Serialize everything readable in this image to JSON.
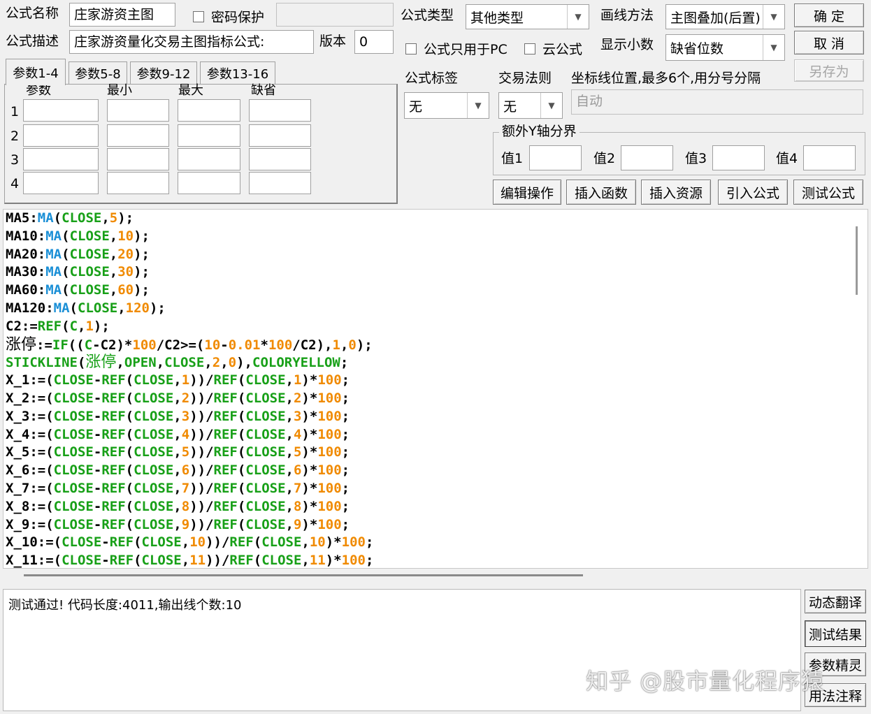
{
  "header": {
    "name_label": "公式名称",
    "name_value": "庄家游资主图",
    "password_label": "密码保护",
    "password_value": "",
    "desc_label": "公式描述",
    "desc_value": "庄家游资量化交易主图指标公式:",
    "version_label": "版本",
    "version_value": "0"
  },
  "settings": {
    "type_label": "公式类型",
    "type_value": "其他类型",
    "draw_label": "画线方法",
    "draw_value": "主图叠加(后置)",
    "pc_only_label": "公式只用于PC",
    "cloud_label": "云公式",
    "decimals_label": "显示小数",
    "decimals_value": "缺省位数",
    "tag_label": "公式标签",
    "tag_value": "无",
    "rule_label": "交易法则",
    "rule_value": "无",
    "axis_label": "坐标线位置,最多6个,用分号分隔",
    "axis_value": "自动",
    "yaxis_group": "额外Y轴分界",
    "y_values": [
      "值1",
      "值2",
      "值3",
      "值4"
    ]
  },
  "buttons": {
    "ok": "确  定",
    "cancel": "取  消",
    "save_as": "另存为",
    "edit": "编辑操作",
    "insert_func": "插入函数",
    "insert_res": "插入资源",
    "import": "引入公式",
    "test": "测试公式",
    "translate": "动态翻译",
    "test_result": "测试结果",
    "param_wizard": "参数精灵",
    "usage_notes": "用法注释"
  },
  "params": {
    "tabs": [
      "参数1-4",
      "参数5-8",
      "参数9-12",
      "参数13-16"
    ],
    "columns": [
      "参数",
      "最小",
      "最大",
      "缺省"
    ],
    "rows": [
      "1",
      "2",
      "3",
      "4"
    ]
  },
  "code_lines": [
    "MA5:MA(CLOSE,5);",
    "MA10:MA(CLOSE,10);",
    "MA20:MA(CLOSE,20);",
    "MA30:MA(CLOSE,30);",
    "MA60:MA(CLOSE,60);",
    "MA120:MA(CLOSE,120);",
    "C2:=REF(C,1);",
    "涨停:=IF((C-C2)*100/C2>=(10-0.01*100/C2),1,0);",
    "STICKLINE(涨停,OPEN,CLOSE,2,0),COLORYELLOW;",
    "X_1:=(CLOSE-REF(CLOSE,1))/REF(CLOSE,1)*100;",
    "X_2:=(CLOSE-REF(CLOSE,2))/REF(CLOSE,2)*100;",
    "X_3:=(CLOSE-REF(CLOSE,3))/REF(CLOSE,3)*100;",
    "X_4:=(CLOSE-REF(CLOSE,4))/REF(CLOSE,4)*100;",
    "X_5:=(CLOSE-REF(CLOSE,5))/REF(CLOSE,5)*100;",
    "X_6:=(CLOSE-REF(CLOSE,6))/REF(CLOSE,6)*100;",
    "X_7:=(CLOSE-REF(CLOSE,7))/REF(CLOSE,7)*100;",
    "X_8:=(CLOSE-REF(CLOSE,8))/REF(CLOSE,8)*100;",
    "X_9:=(CLOSE-REF(CLOSE,9))/REF(CLOSE,9)*100;",
    "X_10:=(CLOSE-REF(CLOSE,10))/REF(CLOSE,10)*100;",
    "X_11:=(CLOSE-REF(CLOSE,11))/REF(CLOSE,11)*100;"
  ],
  "status": {
    "message": "测试通过! 代码长度:4011,输出线个数:10"
  },
  "watermark": "知乎 @股市量化程序猿",
  "colors": {
    "function": "#1a8fd6",
    "keyword": "#18a018",
    "number": "#f08a00",
    "identifier": "#000000"
  }
}
